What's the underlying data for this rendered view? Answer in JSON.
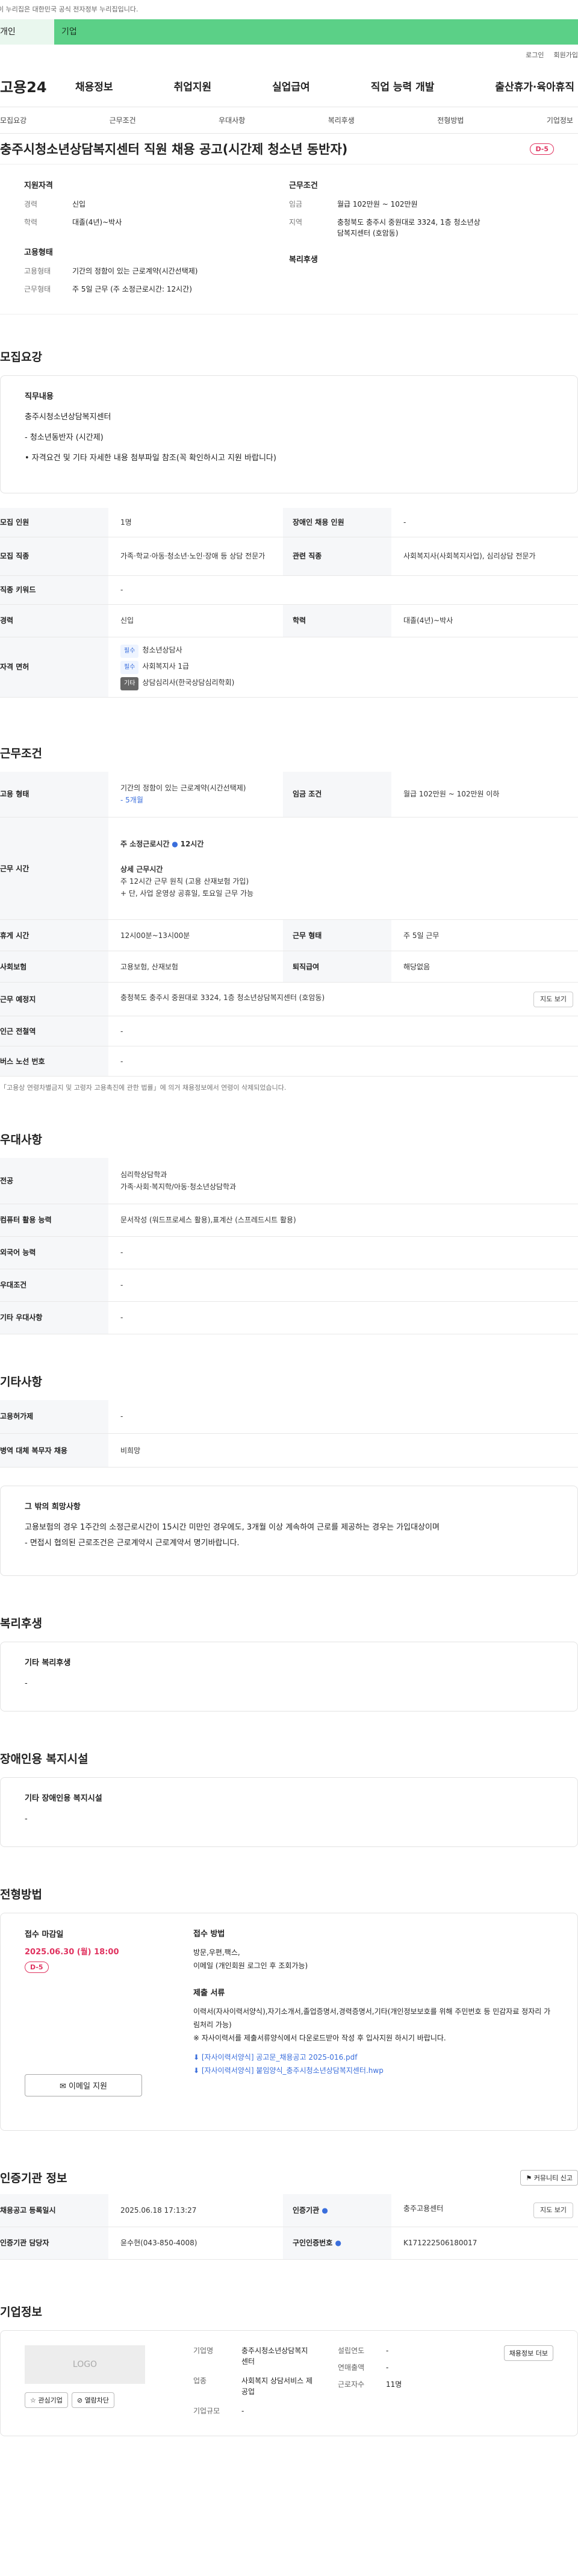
{
  "topnote": "이 누리집은 대한민국 공식 전자정부 누리집입니다.",
  "usertabs": {
    "personal": "개인",
    "company": "기업"
  },
  "util": {
    "login": "로그인",
    "signup": "회원가입"
  },
  "gnb": {
    "logo": "고용24",
    "menu": [
      "채용정보",
      "취업지원",
      "실업급여",
      "직업 능력 개발",
      "출산휴가·육아휴직"
    ]
  },
  "subnav": [
    "모집요강",
    "근무조건",
    "우대사항",
    "복리후생",
    "전형방법",
    "기업정보"
  ],
  "title": "충주시청소년상담복지센터 직원 채용 공고(시간제 청소년 동반자)",
  "dday": "D-5",
  "summary": {
    "applicant_h": "지원자격",
    "career_k": "경력",
    "career_v": "신입",
    "edu_k": "학력",
    "edu_v": "대졸(4년)~박사",
    "type_h": "고용형태",
    "type_k": "고용형태",
    "type_v": "기간의 정함이 있는 근로계약(시간선택제)",
    "worktype_k": "근무형태",
    "worktype_v": "주 5일 근무 (주 소정근로시간: 12시간)",
    "cond_h": "근무조건",
    "wage_k": "임금",
    "wage_v": "월급 102만원 ~ 102만원",
    "area_k": "지역",
    "area_v": "충청북도 충주시 중원대로 3324, 1층 청소년상담복지센터 (호암동)",
    "welfare_h": "복리후생"
  },
  "recruit": {
    "heading": "모집요강",
    "job_h": "직무내용",
    "job_lines": [
      "충주시청소년상담복지센터",
      "- 청소년동반자 (시간제)",
      "• 자격요건 및 기타 자세한 내용 첨부파일 참조(꼭 확인하시고 지원 바랍니다)"
    ],
    "rows": {
      "count_k": "모집 인원",
      "count_v": "1명",
      "disabled_k": "장애인 채용 인원",
      "disabled_v": "-",
      "job_k": "모집 직종",
      "job_v": "가족·학교·아동·청소년·노인·장애 등 상담 전문가",
      "related_k": "관련 직종",
      "related_v": "사회복지사(사회복지사업), 심리상담 전문가",
      "kw_k": "직종 키워드",
      "kw_v": "-",
      "career_k": "경력",
      "career_v": "신입",
      "edu_k": "학력",
      "edu_v": "대졸(4년)~박사",
      "lic_k": "자격 면허",
      "licenses": [
        {
          "chip": "필수",
          "name": "청소년상담사"
        },
        {
          "chip": "필수",
          "name": "사회복지사 1급"
        },
        {
          "chip": "기타",
          "name": "상담심리사(한국상담심리학회)"
        }
      ]
    }
  },
  "work": {
    "heading": "근무조건",
    "type_k": "고용 형태",
    "type_v": "기간의 정함이 있는 근로계약(시간선택제)",
    "type_link": "- 5개월",
    "wage_k": "임금 조건",
    "wage_v": "월급 102만원 ~ 102만원 이하",
    "time_k": "근무 시간",
    "time_a": "주 소정근로시간",
    "time_a_v": "12시간",
    "time_detail_h": "상세 근무시간",
    "time_lines": [
      "주 12시간 근무 원칙 (고용 산재보험 가입)",
      "+ 단, 사업 운영상 공휴일, 토요일 근무 가능"
    ],
    "break_k": "휴게 시간",
    "break_v": "12시00분~13시00분",
    "form_k": "근무 형태",
    "form_v": "주 5일 근무",
    "ins_k": "사회보험",
    "ins_v": "고용보험, 산재보험",
    "ret_k": "퇴직급여",
    "ret_v": "해당없음",
    "place_k": "근무 예정지",
    "place_v": "충청북도 충주시 중원대로 3324, 1층 청소년상담복지센터 (호암동)",
    "map_btn": "지도 보기",
    "subway_k": "인근 전철역",
    "subway_v": "-",
    "bus_k": "버스 노선 번호",
    "bus_v": "-",
    "note": "「고용상 연령차별금지 및 고령자 고용촉진에 관한 법률」에 의거 채용정보에서 연령이 삭제되었습니다."
  },
  "pref": {
    "heading": "우대사항",
    "major_k": "전공",
    "major_v1": "심리학상담학과",
    "major_v2": "가족·사회·복지학/아동·청소년상담학과",
    "pc_k": "컴퓨터 활용 능력",
    "pc_v": "문서작성 (워드프로세스 활용),표계산 (스프레드시트 활용)",
    "lang_k": "외국어 능력",
    "lang_v": "-",
    "cond_k": "우대조건",
    "cond_v": "-",
    "etc_k": "기타 우대사항",
    "etc_v": "-"
  },
  "etc": {
    "heading": "기타사항",
    "ins_k": "고용허가제",
    "ins_v": "-",
    "mil_k": "병역 대체 복무자 채용",
    "mil_v": "비희망",
    "box_h": "그 밖의 희망사항",
    "box_lines": [
      "고용보험의 경우 1주간의 소정근로시간이 15시간 미만인 경우에도, 3개월 이상 계속하여 근로를 제공하는 경우는 가입대상이며",
      "- 면접시 협의된 근로조건은 근로계약시 근로계약서 명기바랍니다."
    ]
  },
  "welfare": {
    "heading": "복리후생",
    "box_h": "기타 복리후생",
    "box_v": "-"
  },
  "disabled": {
    "heading": "장애인용 복지시설",
    "box_h": "기타 장애인용 복지시설",
    "box_v": "-"
  },
  "apply": {
    "heading": "전형방법",
    "deadline_h": "접수 마감일",
    "deadline_v": "2025.06.30 (월) 18:00",
    "dday": "D-5",
    "email_btn": "이메일 지원",
    "method_h": "접수 방법",
    "method_lines": [
      "방문,우편,팩스,",
      "이메일 (개인회원 로그인 후 조회가능)"
    ],
    "doc_h": "제출 서류",
    "doc_lines": [
      "이력서(자사이력서양식),자기소개서,졸업증명서,경력증명서,기타(개인정보보호를 위해 주민번호 등 민감자료 정자리 가림처리 가능)",
      "※ 자사이력서를 제출서류양식에서 다운로드받아 작성 후 입사지원 하시기 바랍니다."
    ],
    "files": [
      "[자사이력서양식] 공고문_채용공고 2025-016.pdf",
      "[자사이력서양식] 붙임양식_충주시청소년상담복지센터.hwp"
    ]
  },
  "cert": {
    "heading": "인증기관 정보",
    "btn": "커뮤니티 신고",
    "reg_k": "채용공고 등록일시",
    "reg_v": "2025.06.18 17:13:27",
    "org_k": "인증기관",
    "org_v": "충주고용센터",
    "map_btn": "지도 보기",
    "mgr_k": "인증기관 담당자",
    "mgr_v": "윤수현(043-850-4008)",
    "num_k": "구인인증번호",
    "num_v": "K171222506180017"
  },
  "company": {
    "heading": "기업정보",
    "logo": "LOGO",
    "fav_btn": "관심기업",
    "block_btn": "열람차단",
    "detail_btn": "채용정보 더보",
    "name_k": "기업명",
    "name_v": "충주시청소년상담복지센터",
    "year_k": "설립연도",
    "year_v": "-",
    "sales_k": "연매출액",
    "sales_v": "-",
    "ind_k": "업종",
    "ind_v": "사회복지 상담서비스 제공업",
    "emp_k": "근로자수",
    "emp_v": "11명",
    "size_k": "기업규모",
    "size_v": "-"
  }
}
